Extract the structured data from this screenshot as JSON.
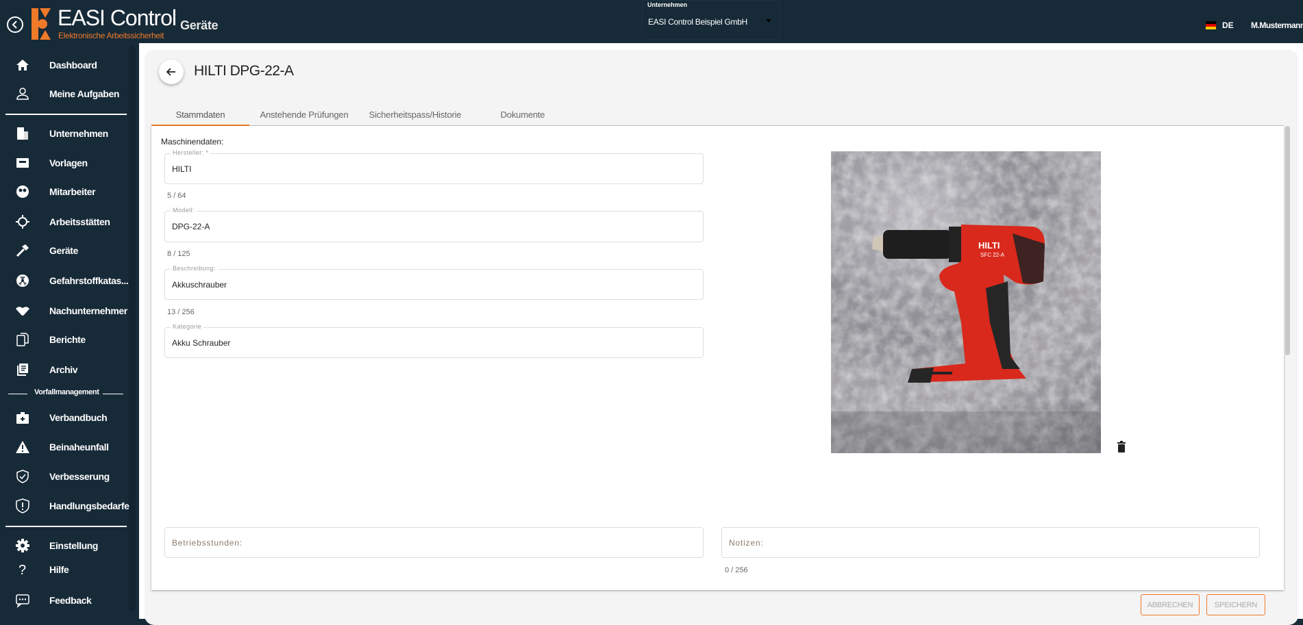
{
  "header": {
    "app_name": "EASI Control",
    "app_subtitle": "Elektronische Arbeitssicherheit",
    "page_title": "Geräte",
    "company_label": "Unternehmen",
    "company_value": "EASI Control Beispiel GmbH",
    "language": "DE",
    "user": "M.Mustermann"
  },
  "sidebar": {
    "items": [
      {
        "label": "Dashboard",
        "icon": "home-icon"
      },
      {
        "label": "Meine Aufgaben",
        "icon": "person-icon"
      },
      {
        "label": "Unternehmen",
        "icon": "building-icon"
      },
      {
        "label": "Vorlagen",
        "icon": "inbox-icon"
      },
      {
        "label": "Mitarbeiter",
        "icon": "group-icon"
      },
      {
        "label": "Arbeitsstätten",
        "icon": "crosshair-icon"
      },
      {
        "label": "Geräte",
        "icon": "hammer-icon"
      },
      {
        "label": "Gefahrstoffkatas...",
        "icon": "radiation-icon"
      },
      {
        "label": "Nachunternehmer",
        "icon": "handshake-icon"
      },
      {
        "label": "Berichte",
        "icon": "documents-icon"
      },
      {
        "label": "Archiv",
        "icon": "archive-icon"
      }
    ],
    "section_label": "Vorfallmanagement",
    "incident_items": [
      {
        "label": "Verbandbuch",
        "icon": "first-aid-icon"
      },
      {
        "label": "Beinaheunfall",
        "icon": "warning-icon"
      },
      {
        "label": "Verbesserung",
        "icon": "shield-check-icon"
      },
      {
        "label": "Handlungsbedarfe",
        "icon": "shield-alert-icon"
      }
    ],
    "bottom_items": [
      {
        "label": "Einstellung",
        "icon": "gear-icon"
      },
      {
        "label": "Hilfe",
        "icon": "help-icon"
      },
      {
        "label": "Feedback",
        "icon": "feedback-icon"
      }
    ]
  },
  "device": {
    "title": "HILTI DPG-22-A",
    "tabs": [
      "Stammdaten",
      "Anstehende Prüfungen",
      "Sicherheitspass/Historie",
      "Dokumente"
    ],
    "active_tab": 0,
    "section_label": "Maschinendaten:",
    "fields": [
      {
        "label": "Hersteller: *",
        "value": "HILTI",
        "counter": "5 / 64"
      },
      {
        "label": "Modell:",
        "value": "DPG-22-A",
        "counter": "8 / 125"
      },
      {
        "label": "Beschreibung:",
        "value": "Akkuschrauber",
        "counter": "13 / 256"
      },
      {
        "label": "Kategorie",
        "value": "Akku Schrauber"
      }
    ],
    "operating_hours_placeholder": "Betriebsstunden:",
    "notes_placeholder": "Notizen:",
    "notes_counter": "0 / 256",
    "image_brand_text": "HILTI",
    "image_model_text": "SFC 22-A"
  },
  "actions": {
    "cancel": "ABBRECHEN",
    "save": "SPEICHERN"
  },
  "colors": {
    "brand_orange": "#f07a2a",
    "navy": "#172a38"
  }
}
